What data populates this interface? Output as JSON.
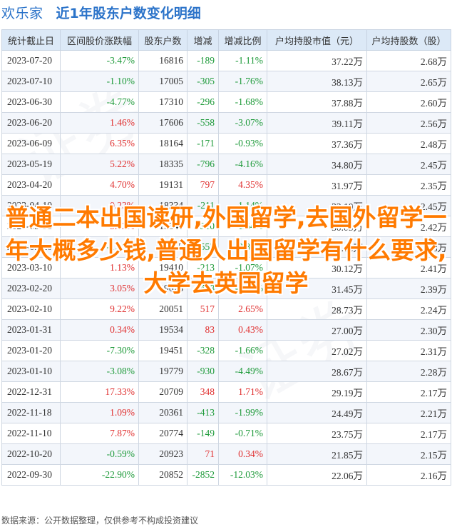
{
  "header": {
    "brand": "欢乐家",
    "title": "近1年股东户数变化明细"
  },
  "columns": [
    "统计截止日",
    "区间股价涨跌幅",
    "股东户数",
    "增减",
    "增减比例",
    "户均持股市值（元）",
    "户均持股数（股）"
  ],
  "rows": [
    {
      "date": "2023-07-20",
      "change": "-3.47%",
      "holders": "16816",
      "delta": "-189",
      "ratio": "-1.11%",
      "value": "37.22万",
      "shares": "2.68万"
    },
    {
      "date": "2023-07-10",
      "change": "-1.10%",
      "holders": "17005",
      "delta": "-305",
      "ratio": "-1.76%",
      "value": "38.13万",
      "shares": "2.65万"
    },
    {
      "date": "2023-06-30",
      "change": "-4.77%",
      "holders": "17310",
      "delta": "-296",
      "ratio": "-1.68%",
      "value": "37.88万",
      "shares": "2.60万"
    },
    {
      "date": "2023-06-20",
      "change": "1.46%",
      "holders": "17606",
      "delta": "-558",
      "ratio": "-3.07%",
      "value": "39.11万",
      "shares": "2.56万"
    },
    {
      "date": "2023-06-09",
      "change": "6.35%",
      "holders": "18164",
      "delta": "-171",
      "ratio": "-0.93%",
      "value": "37.36万",
      "shares": "2.48万"
    },
    {
      "date": "2023-05-19",
      "change": "5.22%",
      "holders": "18335",
      "delta": "-796",
      "ratio": "-4.16%",
      "value": "34.80万",
      "shares": "2.45万"
    },
    {
      "date": "2023-04-20",
      "change": "4.70%",
      "holders": "19131",
      "delta": "797",
      "ratio": "4.35%",
      "value": "31.97万",
      "shares": "2.35万"
    },
    {
      "date": "2023-04-10",
      "change": "0.23%",
      "holders": "18334",
      "delta": "-211",
      "ratio": "-1.14%",
      "value": "32.10万",
      "shares": "2.45万"
    },
    {
      "date": "2023-03-31",
      "change": "5.12%",
      "holders": "18545",
      "delta": "-310",
      "ratio": "-1.64%",
      "value": "30.05万",
      "shares": "2.42万"
    },
    {
      "date": "2023-03-20",
      "change": "-1.10%",
      "holders": "18855",
      "delta": "-555",
      "ratio": "-2.86%",
      "value": "29.86万",
      "shares": "2.38万"
    },
    {
      "date": "2023-03-10",
      "change": "1.13%",
      "holders": "19410",
      "delta": "-213",
      "ratio": "-1.07%",
      "value": "30.12万",
      "shares": "2.41万"
    },
    {
      "date": "2023-02-20",
      "change": "3.05%",
      "holders": "19623",
      "delta": "-428",
      "ratio": "-2.13%",
      "value": "31.45万",
      "shares": "2.39万"
    },
    {
      "date": "2023-02-10",
      "change": "9.22%",
      "holders": "20051",
      "delta": "517",
      "ratio": "2.65%",
      "value": "28.73万",
      "shares": "2.24万"
    },
    {
      "date": "2023-01-31",
      "change": "0.34%",
      "holders": "19534",
      "delta": "83",
      "ratio": "0.43%",
      "value": "27.00万",
      "shares": "2.30万"
    },
    {
      "date": "2023-01-20",
      "change": "-7.30%",
      "holders": "19451",
      "delta": "-328",
      "ratio": "-1.66%",
      "value": "27.02万",
      "shares": "2.31万"
    },
    {
      "date": "2023-01-10",
      "change": "-3.08%",
      "holders": "19779",
      "delta": "-930",
      "ratio": "-4.49%",
      "value": "28.67万",
      "shares": "2.28万"
    },
    {
      "date": "2022-12-31",
      "change": "17.33%",
      "holders": "20709",
      "delta": "348",
      "ratio": "1.71%",
      "value": "29.19万",
      "shares": "2.17万"
    },
    {
      "date": "2022-11-18",
      "change": "1.09%",
      "holders": "20361",
      "delta": "-413",
      "ratio": "-1.99%",
      "value": "24.49万",
      "shares": "2.21万"
    },
    {
      "date": "2022-11-10",
      "change": "7.87%",
      "holders": "20774",
      "delta": "-149",
      "ratio": "-0.71%",
      "value": "23.75万",
      "shares": "2.17万"
    },
    {
      "date": "2022-10-20",
      "change": "-0.59%",
      "holders": "20923",
      "delta": "71",
      "ratio": "0.34%",
      "value": "21.85万",
      "shares": "2.15万"
    },
    {
      "date": "2022-09-30",
      "change": "-22.90%",
      "holders": "20852",
      "delta": "-2852",
      "ratio": "-12.03%",
      "value": "22.06万",
      "shares": "2.16万"
    }
  ],
  "overlay_text": "普通二本出国读研,外国留学,去国外留学一年大概多少钱,普通人出国留学有什么要求,大学去英国留学",
  "footer": "数据来源：公开数据整理，仅供参考不构成投资建议",
  "colors": {
    "positive": "#e03030",
    "negative": "#1e9a3a",
    "header_bg": "#dce9f7",
    "title": "#2b73c9",
    "overlay": "#ff7a00"
  }
}
